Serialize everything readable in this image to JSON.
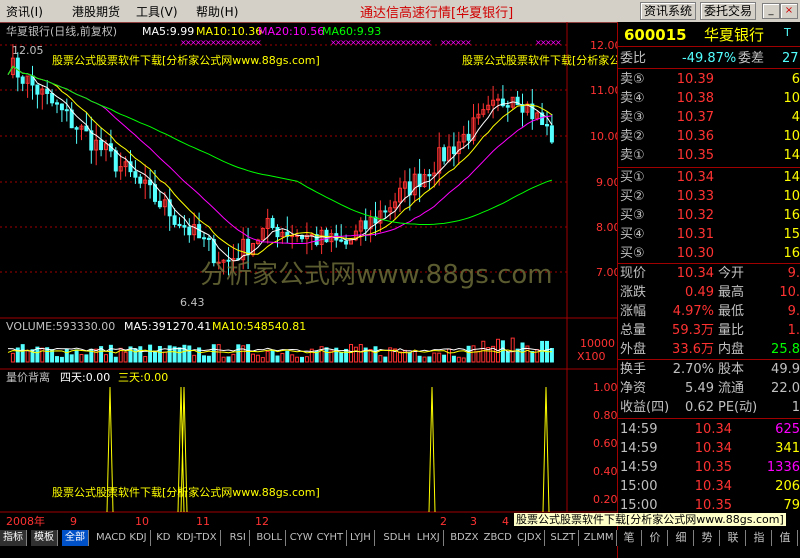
{
  "menu": [
    {
      "label": "资讯(I)"
    },
    {
      "label": "港股期货"
    },
    {
      "label": "工具(V)"
    },
    {
      "label": "帮助(H)"
    }
  ],
  "app_title": "通达信高速行情[华夏银行]",
  "top_buttons": {
    "info_sys": "资讯系统",
    "trade": "委托交易"
  },
  "window_buttons": {
    "min": "_",
    "max": "□",
    "close": "×"
  },
  "chart_header": {
    "stock": "华夏银行(日线,前复权)",
    "ma5": "MA5:9.99",
    "ma10": "MA10:10.36",
    "ma20": "MA20:10.56",
    "ma60": "MA60:9.93"
  },
  "watermarks": {
    "left": "股票公式股票软件下载[分析家公式网www.88gs.com]",
    "right": "股票公式股票软件下载[分析家公式网www.88gs.com]",
    "center": "分析家公式网www.88gs.com",
    "indicator": "股票公式股票软件下载[分析家公式网www.88gs.com]",
    "bottom_right": "股票公式股票软件下载[分析家公式网www.88gs.com]"
  },
  "price_marks": {
    "high": "12.05",
    "low": "6.43"
  },
  "y_ticks": [
    "12.00",
    "11.00",
    "10.00",
    "9.00",
    "8.00",
    "7.00"
  ],
  "volume_header": {
    "label": "VOLUME:593330.00",
    "ma5": "MA5:391270.41",
    "ma10": "MA10:548540.81"
  },
  "volume_tick": "10000",
  "volume_unit": "X100",
  "indicator_header": {
    "label": "量价背离",
    "four": "四天:0.00",
    "three": "三天:0.00"
  },
  "indicator_ticks": [
    "1.00",
    "0.80",
    "0.60",
    "0.40",
    "0.20"
  ],
  "time_axis": {
    "year": "2008年",
    "months": [
      "9",
      "10",
      "11",
      "12",
      "2",
      "3",
      "4"
    ]
  },
  "tabs": [
    "指标",
    "模板",
    "全部",
    "MACD",
    "KDJ",
    "KD",
    "KDJ-TDX",
    "RSI",
    "BOLL",
    "CYW",
    "CYHT",
    "LYJH",
    "SDLH",
    "LHXJ",
    "BDZX",
    "ZBCD",
    "CJDX",
    "SLZT",
    "ZLMM"
  ],
  "bottom_right_tabs": [
    "笔",
    "价",
    "细",
    "势",
    "联",
    "指",
    "值"
  ],
  "quote": {
    "code": "600015",
    "name": "华夏银行",
    "flag": "T",
    "weibi_label": "委比",
    "weibi_value": "-49.87%",
    "weicha_label": "委差",
    "weicha_value": "27",
    "sells": [
      {
        "label": "卖⑤",
        "price": "10.39",
        "vol": "6"
      },
      {
        "label": "卖④",
        "price": "10.38",
        "vol": "10"
      },
      {
        "label": "卖③",
        "price": "10.37",
        "vol": "4"
      },
      {
        "label": "卖②",
        "price": "10.36",
        "vol": "10"
      },
      {
        "label": "卖①",
        "price": "10.35",
        "vol": "14"
      }
    ],
    "buys": [
      {
        "label": "买①",
        "price": "10.34",
        "vol": "14"
      },
      {
        "label": "买②",
        "price": "10.33",
        "vol": "10"
      },
      {
        "label": "买③",
        "price": "10.32",
        "vol": "16"
      },
      {
        "label": "买④",
        "price": "10.31",
        "vol": "15"
      },
      {
        "label": "买⑤",
        "price": "10.30",
        "vol": "16"
      }
    ],
    "stats": [
      {
        "l1": "现价",
        "v1": "10.34",
        "l2": "今开",
        "v2": "9."
      },
      {
        "l1": "涨跌",
        "v1": "0.49",
        "l2": "最高",
        "v2": "10."
      },
      {
        "l1": "涨幅",
        "v1": "4.97%",
        "l2": "最低",
        "v2": "9."
      },
      {
        "l1": "总量",
        "v1": "59.3万",
        "l2": "量比",
        "v2": "1."
      },
      {
        "l1": "外盘",
        "v1": "33.6万",
        "l2": "内盘",
        "v2": "25.8"
      }
    ],
    "stats2": [
      {
        "l1": "换手",
        "v1": "2.70%",
        "l2": "股本",
        "v2": "49.9"
      },
      {
        "l1": "净资",
        "v1": "5.49",
        "l2": "流通",
        "v2": "22.0"
      },
      {
        "l1": "收益(四)",
        "v1": "0.62",
        "l2": "PE(动)",
        "v2": "1"
      }
    ],
    "ticks": [
      {
        "time": "14:59",
        "price": "10.34",
        "vol": "625"
      },
      {
        "time": "14:59",
        "price": "10.34",
        "vol": "341"
      },
      {
        "time": "14:59",
        "price": "10.35",
        "vol": "1336"
      },
      {
        "time": "15:00",
        "price": "10.34",
        "vol": "206"
      },
      {
        "time": "15:00",
        "price": "10.35",
        "vol": "79"
      }
    ]
  },
  "colors": {
    "up": "#ff3232",
    "down": "#54ffff",
    "ma5": "#ffffff",
    "ma10": "#ffff00",
    "ma20": "#ff00ff",
    "ma60": "#00ff00",
    "text_yellow": "#ffff00",
    "frame": "#a00000"
  }
}
